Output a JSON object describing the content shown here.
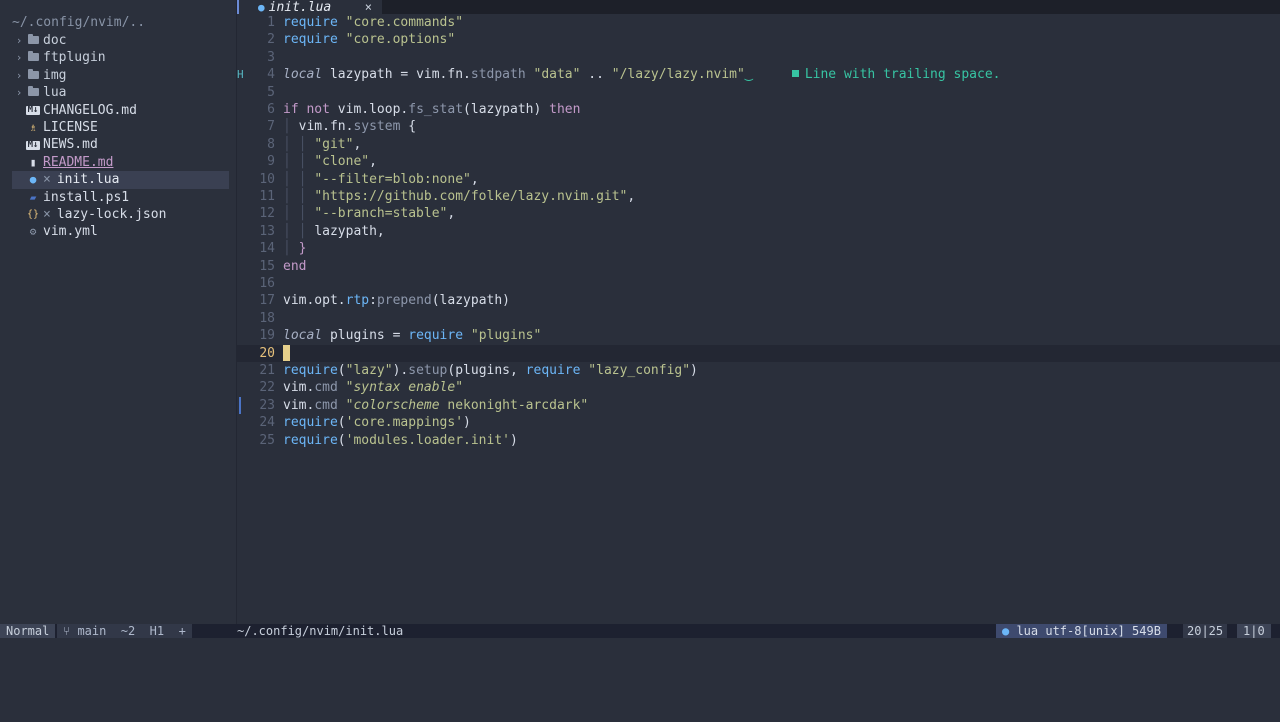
{
  "sidebar": {
    "path": "~/.config/nvim/..",
    "items": [
      {
        "label": "doc",
        "kind": "folder"
      },
      {
        "label": "ftplugin",
        "kind": "folder"
      },
      {
        "label": "img",
        "kind": "folder"
      },
      {
        "label": "lua",
        "kind": "folder"
      },
      {
        "label": "CHANGELOG.md",
        "kind": "markdown"
      },
      {
        "label": "LICENSE",
        "kind": "license"
      },
      {
        "label": "NEWS.md",
        "kind": "markdown"
      },
      {
        "label": "README.md",
        "kind": "readme"
      },
      {
        "label": "init.lua",
        "kind": "lua",
        "mark": "×"
      },
      {
        "label": "install.ps1",
        "kind": "powershell"
      },
      {
        "label": "lazy-lock.json",
        "kind": "json",
        "mark": "×"
      },
      {
        "label": "vim.yml",
        "kind": "yaml"
      }
    ],
    "colors": {
      "json_icon": "#e5c07b",
      "lua_icon": "#6cb6f7",
      "license_icon": "#e5c07b"
    }
  },
  "tab": {
    "label": "init.lua",
    "close": "×"
  },
  "editor": {
    "current_line": 20,
    "diagnostic": "Line with trailing space.",
    "sign_h": "H",
    "line_numbers": [
      "1",
      "2",
      "3",
      "4",
      "5",
      "6",
      "7",
      "8",
      "9",
      "10",
      "11",
      "12",
      "13",
      "14",
      "15",
      "16",
      "17",
      "18",
      "19",
      "20",
      "21",
      "22",
      "23",
      "24",
      "25"
    ]
  },
  "status": {
    "mode": "Normal",
    "git": "main  ~2  H1  +",
    "file_path": "~/.config/nvim/init.lua",
    "filetype": "lua utf-8[unix] 549B",
    "position": "20|25",
    "column": "1|0"
  },
  "colors": {
    "accent": "#6cb6f7",
    "string": "#b9c28f",
    "diagnostic": "#37c4a3",
    "cursor": "#e5cf8b"
  }
}
